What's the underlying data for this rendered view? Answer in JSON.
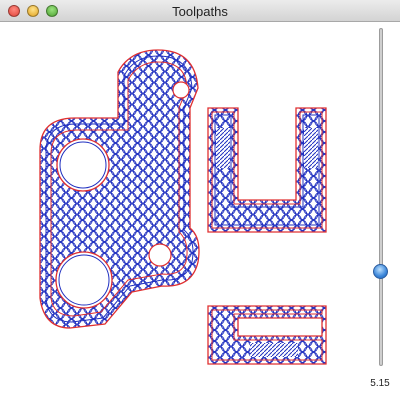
{
  "window": {
    "title": "Toolpaths"
  },
  "slider": {
    "value": "5.15",
    "level": 0.27
  },
  "colors": {
    "outline": "#e03030",
    "fill": "#2030c0",
    "background": "#ffffff"
  }
}
